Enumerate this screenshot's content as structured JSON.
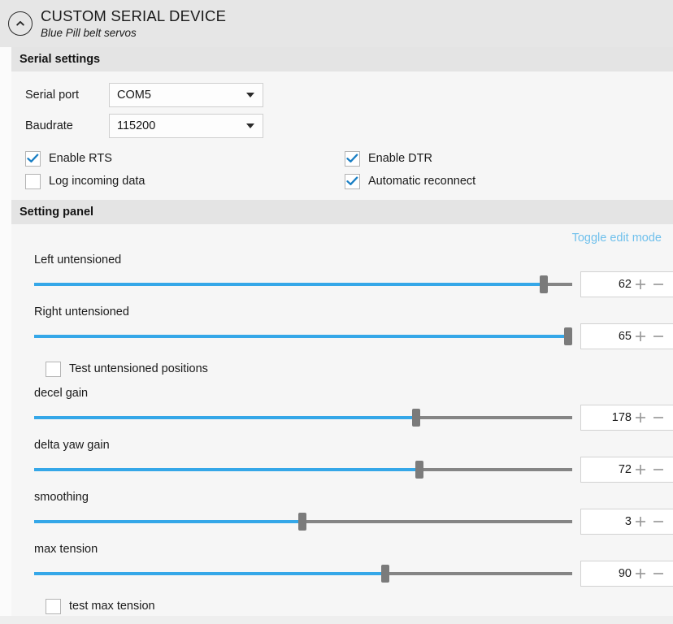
{
  "device": {
    "collapse_icon": "chevron-up-circle-icon",
    "title": "CUSTOM SERIAL DEVICE",
    "subtitle": "Blue Pill belt servos"
  },
  "serial_section": {
    "header": "Serial settings",
    "fields": [
      {
        "label": "Serial port",
        "value": "COM5",
        "icon": "chevron-down-icon"
      },
      {
        "label": "Baudrate",
        "value": "115200",
        "icon": "chevron-down-icon"
      }
    ],
    "checkboxes": [
      {
        "label": "Enable RTS",
        "checked": true
      },
      {
        "label": "Log incoming data",
        "checked": false
      },
      {
        "label": "Enable DTR",
        "checked": true
      },
      {
        "label": "Automatic reconnect",
        "checked": true
      }
    ]
  },
  "setting_panel": {
    "header": "Setting panel",
    "toggle_edit_label": "Toggle edit mode",
    "sliders": [
      {
        "label": "Left untensioned",
        "value": "62",
        "fill_percent": 94.7
      },
      {
        "label": "Right untensioned",
        "value": "65",
        "fill_percent": 99.2
      },
      {
        "label": "decel gain",
        "value": "178",
        "fill_percent": 71.0
      },
      {
        "label": "delta yaw gain",
        "value": "72",
        "fill_percent": 71.6
      },
      {
        "label": "smoothing",
        "value": "3",
        "fill_percent": 49.8
      },
      {
        "label": "max tension",
        "value": "90",
        "fill_percent": 65.3
      }
    ],
    "checkbox_mid": {
      "label": "Test untensioned positions",
      "checked": false
    },
    "checkbox_bottom": {
      "label": "test max tension",
      "checked": false
    },
    "stepper_plus_icon": "plus-icon",
    "stepper_minus_icon": "minus-icon"
  },
  "colors": {
    "accent_blue": "#35a7e8",
    "link_blue": "#6fc0ec",
    "check_blue": "#1a7fc4",
    "track_gray": "#858585",
    "thumb_gray": "#7b7b7b"
  }
}
